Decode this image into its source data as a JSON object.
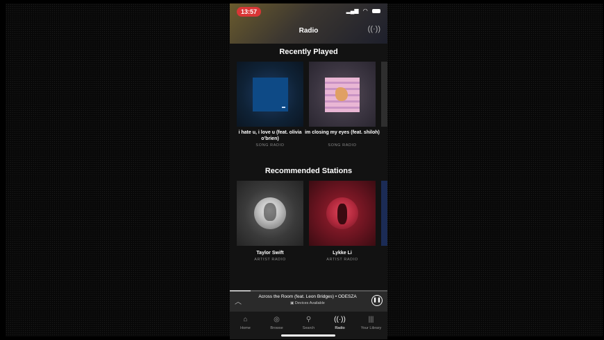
{
  "status_bar": {
    "time": "13:57",
    "signal_icon": "signal-bars-icon",
    "wifi_icon": "wifi-icon",
    "battery_icon": "battery-icon"
  },
  "header": {
    "title": "Radio",
    "cast_icon": "cast-icon"
  },
  "recently_played": {
    "title": "Recently Played",
    "items": [
      {
        "title": "i hate u, i love u (feat. olivia o'brien)",
        "subtitle": "SONG RADIO"
      },
      {
        "title": "im closing my eyes (feat. shiloh)",
        "subtitle": "SONG RADIO"
      }
    ]
  },
  "recommended": {
    "title": "Recommended Stations",
    "items": [
      {
        "title": "Taylor Swift",
        "subtitle": "ARTIST RADIO"
      },
      {
        "title": "Lykke Li",
        "subtitle": "ARTIST RADIO"
      }
    ]
  },
  "now_playing": {
    "track": "Across the Room (feat. Leon Bridges) • ODESZA",
    "devices": "Devices Available",
    "progress": 0.13
  },
  "tabs": [
    {
      "label": "Home",
      "icon": "home-icon",
      "active": false
    },
    {
      "label": "Browse",
      "icon": "browse-icon",
      "active": false
    },
    {
      "label": "Search",
      "icon": "search-icon",
      "active": false
    },
    {
      "label": "Radio",
      "icon": "radio-icon",
      "active": true
    },
    {
      "label": "Your Library",
      "icon": "library-icon",
      "active": false
    }
  ],
  "colors": {
    "background": "#121212",
    "time_pill": "#d93636",
    "accent_white": "#ffffff"
  }
}
